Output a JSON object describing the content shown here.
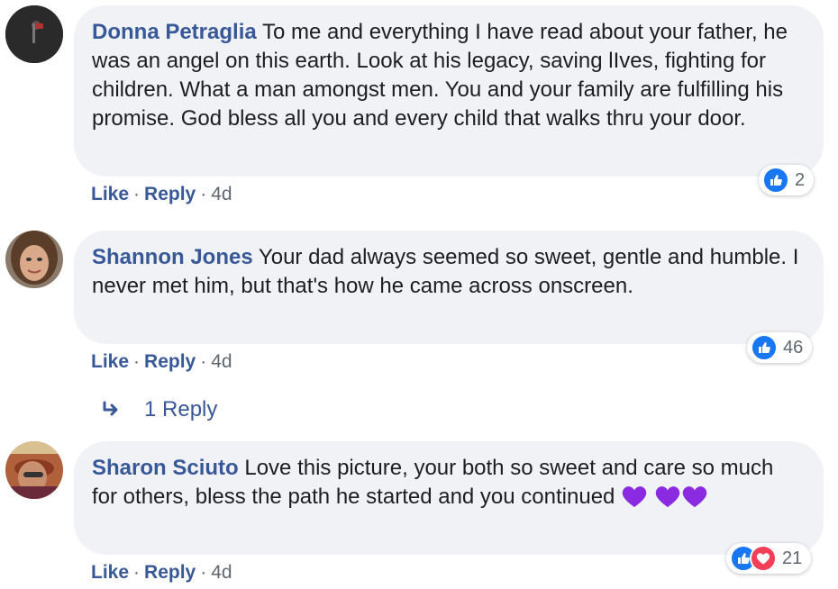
{
  "comments": [
    {
      "author": "Donna Petraglia",
      "text": "To me and everything I have read about your father, he was an angel on this earth. Look at his legacy, saving lIves, fighting for children. What a man amongst men. You and your family are fulfilling his promise. God bless all you and every child that walks thru your door.",
      "like_label": "Like",
      "reply_label": "Reply",
      "time": "4d",
      "reaction_count": "2"
    },
    {
      "author": "Shannon Jones",
      "text": "Your dad always seemed so sweet, gentle and humble. I never met him, but that's how he came across onscreen.",
      "like_label": "Like",
      "reply_label": "Reply",
      "time": "4d",
      "reaction_count": "46"
    },
    {
      "author": "Sharon Sciuto",
      "text": "Love this picture, your both so sweet and care so much for others, bless the path he started and you continued",
      "like_label": "Like",
      "reply_label": "Reply",
      "time": "4d",
      "reaction_count": "21"
    }
  ],
  "replies_link": "1 Reply",
  "separator": "·",
  "colors": {
    "link": "#385898",
    "bubble": "#f0f2f5",
    "like": "#1877f2",
    "love": "#f33e58",
    "heart_emoji": "#8a2be2"
  },
  "icons": [
    "like-icon",
    "love-icon",
    "purple-heart-icon",
    "reply-arrow-icon"
  ]
}
